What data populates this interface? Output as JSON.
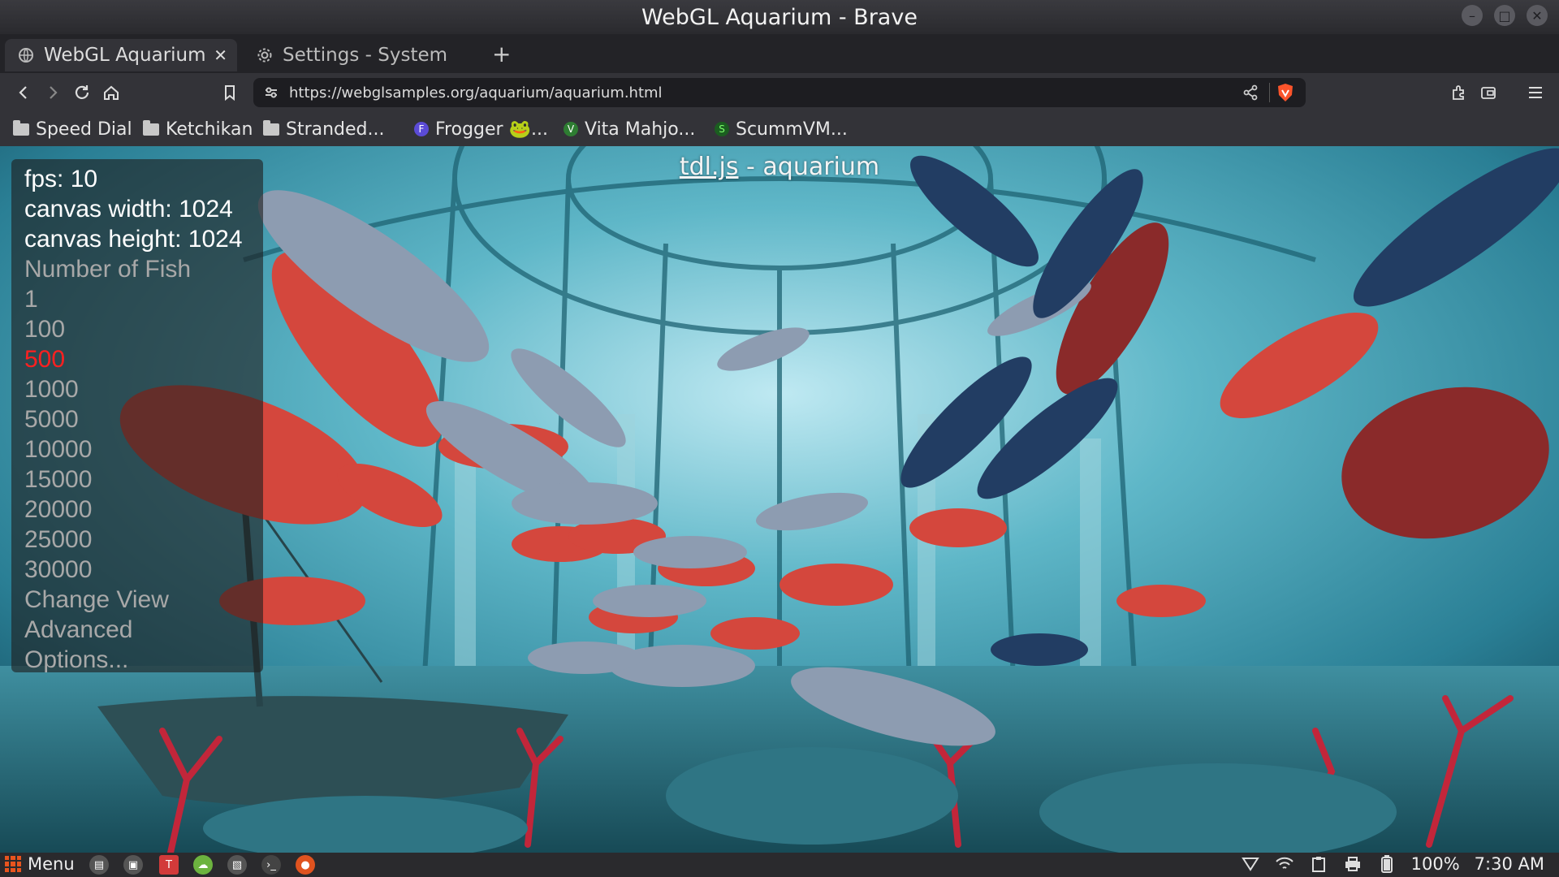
{
  "window": {
    "title": "WebGL Aquarium - Brave"
  },
  "tabs": [
    {
      "label": "WebGL Aquarium",
      "active": true
    },
    {
      "label": "Settings - System",
      "active": false
    }
  ],
  "toolbar": {
    "url": "https://webglsamples.org/aquarium/aquarium.html"
  },
  "bookmarks": [
    {
      "label": "Speed Dial",
      "icon": "folder-icon"
    },
    {
      "label": "Ketchikan",
      "icon": "folder-icon"
    },
    {
      "label": "Stranded...",
      "icon": "folder-icon"
    },
    {
      "label": "Frogger 🐸...",
      "icon": "frogger-favicon"
    },
    {
      "label": "Vita Mahjo...",
      "icon": "vita-favicon"
    },
    {
      "label": "ScummVM...",
      "icon": "scummvm-favicon"
    }
  ],
  "page": {
    "title_link": "tdl.js",
    "title_rest": " - aquarium",
    "stats": {
      "fps": "fps: 10",
      "width": "canvas width: 1024",
      "height": "canvas height: 1024"
    },
    "fish_heading": "Number of Fish",
    "fish_options": [
      "1",
      "100",
      "500",
      "1000",
      "5000",
      "10000",
      "15000",
      "20000",
      "25000",
      "30000"
    ],
    "selected_fish": "500",
    "change_view": "Change View",
    "advanced": "Advanced",
    "options": "Options..."
  },
  "taskbar": {
    "menu_label": "Menu",
    "battery": "100%",
    "time": "7:30 AM"
  },
  "colors": {
    "selected_option": "#ff2020",
    "brave_orange": "#fb542b"
  }
}
